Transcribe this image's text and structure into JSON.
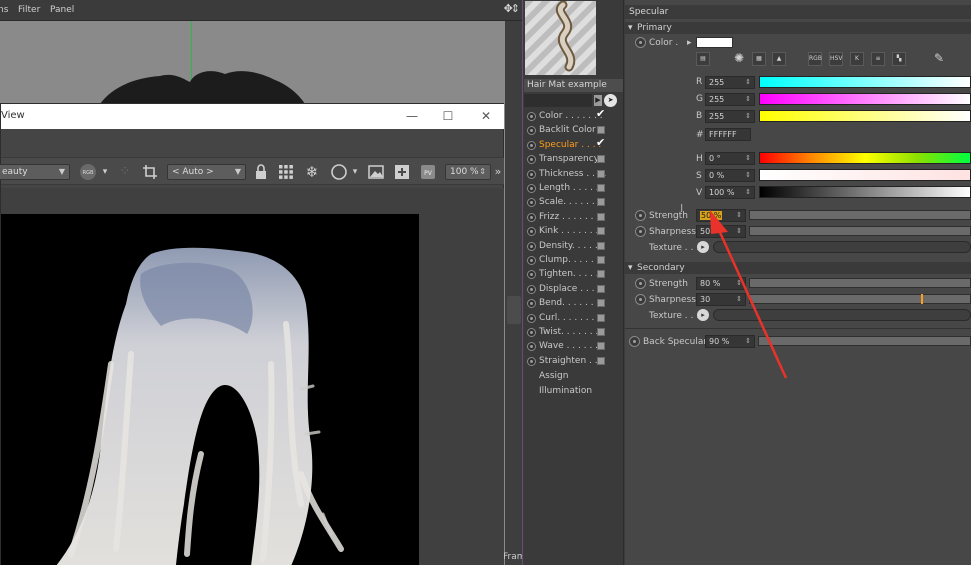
{
  "viewport": {
    "menus": [
      "ns",
      "Filter",
      "Panel"
    ],
    "nav_glyph": "✥⇕",
    "frame_label": "Fram"
  },
  "picture_viewer": {
    "title": "View",
    "min_glyph": "—",
    "max_glyph": "☐",
    "close_glyph": "✕",
    "toolbar": {
      "display_mode": "eauty",
      "auto_select": "< Auto >",
      "zoom": "100 %",
      "rgb_badge": "RGB",
      "pv_badge": "PV",
      "more": "»"
    }
  },
  "material": {
    "name": "Hair Mat example",
    "channels": [
      {
        "label": "Color . . . . . . .",
        "checked": true,
        "active": false
      },
      {
        "label": "Backlit Color",
        "checked": false,
        "active": false
      },
      {
        "label": "Specular . . . .",
        "checked": true,
        "active": true
      },
      {
        "label": "Transparency",
        "checked": false,
        "active": false
      },
      {
        "label": "Thickness . . . .",
        "checked": false,
        "active": false
      },
      {
        "label": "Length . . . . . .",
        "checked": false,
        "active": false
      },
      {
        "label": "Scale. . . . . . .",
        "checked": false,
        "active": false
      },
      {
        "label": "Frizz . . . . . . .",
        "checked": false,
        "active": false
      },
      {
        "label": "Kink . . . . . . .",
        "checked": false,
        "active": false
      },
      {
        "label": "Density. . . . . .",
        "checked": false,
        "active": false
      },
      {
        "label": "Clump. . . . . . .",
        "checked": false,
        "active": false
      },
      {
        "label": "Tighten. . . . . .",
        "checked": false,
        "active": false
      },
      {
        "label": "Displace . . . .",
        "checked": false,
        "active": false
      },
      {
        "label": "Bend. . . . . . .",
        "checked": false,
        "active": false
      },
      {
        "label": "Curl. . . . . . . .",
        "checked": false,
        "active": false
      },
      {
        "label": "Twist. . . . . . .",
        "checked": false,
        "active": false
      },
      {
        "label": "Wave . . . . . . .",
        "checked": false,
        "active": false
      },
      {
        "label": "Straighten . .",
        "checked": false,
        "active": false
      }
    ],
    "extra_items": [
      "Assign",
      "Illumination"
    ]
  },
  "attributes": {
    "header": "Specular",
    "primary": {
      "title": "Primary",
      "color_label": "Color .",
      "color_hex_swatch": "#ffffff",
      "mode_buttons": [
        "RGB",
        "HSV"
      ],
      "r_label": "R",
      "r_value": "255",
      "g_label": "G",
      "g_value": "255",
      "b_label": "B",
      "b_value": "255",
      "hex_label": "#",
      "hex_value": "FFFFFF",
      "h_label": "H",
      "h_value": "0 °",
      "s_label": "S",
      "s_value": "0 %",
      "v_label": "V",
      "v_value": "100 %",
      "strength_label": "Strength",
      "strength_value": "50 %",
      "strength_level": 0.5,
      "sharpness_label": "Sharpness",
      "sharpness_value": "50",
      "texture_label": "Texture . . ."
    },
    "secondary": {
      "title": "Secondary",
      "strength_label": "Strength",
      "strength_value": "80 %",
      "strength_level": 0.8,
      "sharpness_label": "Sharpness",
      "sharpness_value": "30",
      "sharpness_level": 0.3,
      "texture_label": "Texture . . ."
    },
    "back_specular": {
      "label": "Back Specular",
      "value": "90 %",
      "level": 0.9
    },
    "colors": {
      "accent": "#ff9c1a",
      "annotation_arrow": "#e8322a"
    }
  }
}
